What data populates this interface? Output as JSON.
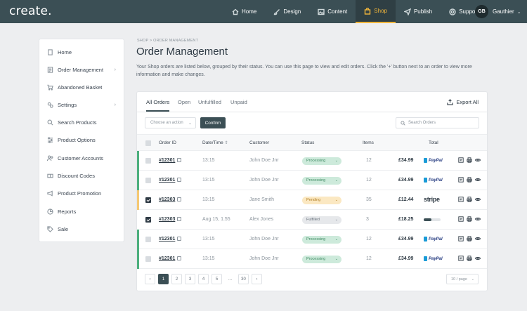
{
  "brand": {
    "logo": "create."
  },
  "nav": [
    {
      "label": "Home",
      "icon": "home-icon"
    },
    {
      "label": "Design",
      "icon": "brush-icon"
    },
    {
      "label": "Content",
      "icon": "image-icon"
    },
    {
      "label": "Shop",
      "icon": "shopping-bag-icon",
      "active": true
    },
    {
      "label": "Publish",
      "icon": "send-icon"
    },
    {
      "label": "Support",
      "icon": "lifebuoy-icon"
    }
  ],
  "user": {
    "initials": "GB",
    "name": "Gauthier"
  },
  "sidebar": {
    "items": [
      {
        "label": "Home"
      },
      {
        "label": "Order Management",
        "has_submenu": true
      },
      {
        "label": "Abandoned Basket"
      },
      {
        "label": "Settings",
        "has_submenu": true
      },
      {
        "label": "Search Products"
      },
      {
        "label": "Product Options"
      },
      {
        "label": "Customer Accounts"
      },
      {
        "label": "Discount Codes"
      },
      {
        "label": "Product Promotion"
      },
      {
        "label": "Reports"
      },
      {
        "label": "Sale"
      }
    ]
  },
  "page": {
    "breadcrumb": "SHOP > ORDER MANAGEMENT",
    "title": "Order Management",
    "description": "Your Shop orders are listed below, grouped by their status. You can use this page to view and edit orders. Click the '+' button next to an order to view more information and make changes."
  },
  "tabs": [
    {
      "label": "All Orders",
      "active": true
    },
    {
      "label": "Open"
    },
    {
      "label": "Unfulfilled"
    },
    {
      "label": "Unpaid"
    }
  ],
  "toolbar": {
    "export_label": "Export All",
    "action_placeholder": "Choose an action",
    "confirm_label": "Confirm",
    "search_placeholder": "Search Orders"
  },
  "table": {
    "columns": [
      "Order ID",
      "Date/Time",
      "Customer",
      "Status",
      "Items",
      "Total"
    ],
    "rows": [
      {
        "id": "#12301",
        "date": "13:15",
        "customer": "John Doe Jnr",
        "status": "Processing",
        "items": "12",
        "total": "£34.99",
        "payment": "PayPal",
        "checked": false,
        "stripe_color": "#4caf7d",
        "badge_bg": "#cdeadb",
        "badge_fg": "#3f8a62"
      },
      {
        "id": "#12301",
        "date": "13:15",
        "customer": "John Doe Jnr",
        "status": "Processing",
        "items": "12",
        "total": "£34.99",
        "payment": "PayPal",
        "checked": false,
        "stripe_color": "#4caf7d",
        "badge_bg": "#cdeadb",
        "badge_fg": "#3f8a62"
      },
      {
        "id": "#12303",
        "date": "13:15",
        "customer": "Jane Smith",
        "status": "Pending",
        "items": "35",
        "total": "£12.44",
        "payment": "stripe",
        "checked": true,
        "stripe_color": "#f5c873",
        "badge_bg": "#fbe8c2",
        "badge_fg": "#b07d22"
      },
      {
        "id": "#12303",
        "date": "Aug 15, 1.55",
        "customer": "Alex Jones",
        "status": "Fulfilled",
        "items": "3",
        "total": "£18.25",
        "payment": "progress",
        "progress": 0.45,
        "checked": true,
        "stripe_color": "#ffffff",
        "badge_bg": "#e6e8eb",
        "badge_fg": "#66707a"
      },
      {
        "id": "#12301",
        "date": "13:15",
        "customer": "John Doe Jnr",
        "status": "Processing",
        "items": "12",
        "total": "£34.99",
        "payment": "PayPal",
        "checked": false,
        "stripe_color": "#4caf7d",
        "badge_bg": "#cdeadb",
        "badge_fg": "#3f8a62"
      },
      {
        "id": "#12301",
        "date": "13:15",
        "customer": "John Doe Jnr",
        "status": "Processing",
        "items": "12",
        "total": "£34.99",
        "payment": "PayPal",
        "checked": false,
        "stripe_color": "#4caf7d",
        "badge_bg": "#cdeadb",
        "badge_fg": "#3f8a62"
      }
    ]
  },
  "pagination": {
    "prev": "‹",
    "pages": [
      "1",
      "2",
      "3",
      "4",
      "5",
      "...",
      "30"
    ],
    "active": "1",
    "next": "›",
    "per_page": "10 / page"
  }
}
